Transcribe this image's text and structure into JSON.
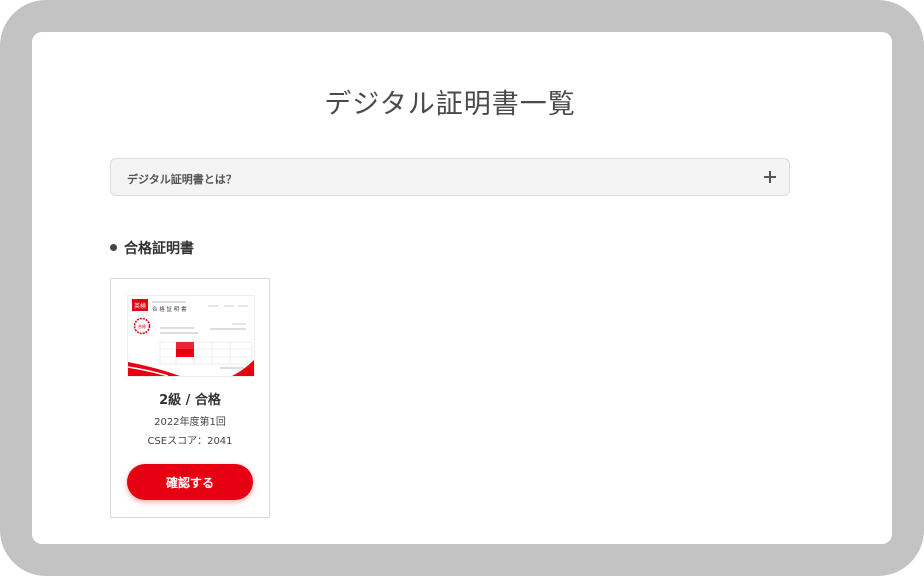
{
  "page": {
    "title": "デジタル証明書一覧"
  },
  "faq": {
    "label": "デジタル証明書とは？",
    "toggle_icon": "plus-icon"
  },
  "section": {
    "heading": "合格証明書"
  },
  "certificates": [
    {
      "grade": "2級 / 合格",
      "session": "2022年度第1回",
      "score": "CSEスコア：2041",
      "button_label": "確認する",
      "thumbnail_title": "合 格 証 明 書",
      "thumbnail_logo": "英検",
      "thumbnail_seal": "合格"
    }
  ],
  "colors": {
    "accent": "#e60012",
    "frame": "#c3c3c3",
    "panel": "#ffffff"
  }
}
